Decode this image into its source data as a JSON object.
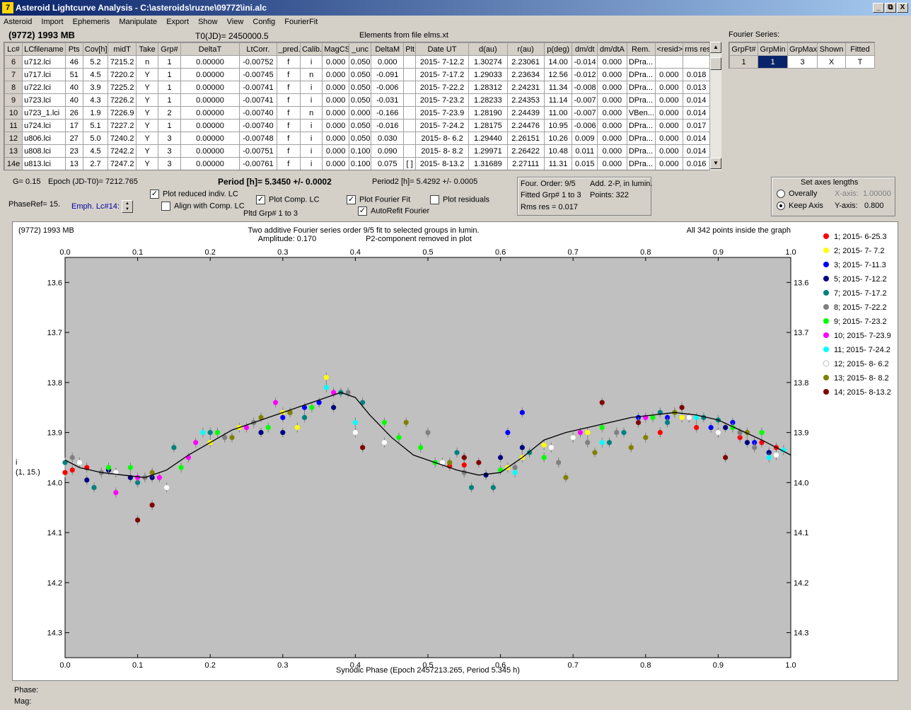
{
  "window": {
    "title": "Asteroid Lightcurve Analysis - C:\\asteroids\\ruzne\\09772\\ini.alc",
    "app_icon": "7",
    "buttons": [
      "_",
      "⧉",
      "X"
    ]
  },
  "menu": [
    "Asteroid",
    "Import",
    "Ephemeris",
    "Manipulate",
    "Export",
    "Show",
    "View",
    "Config",
    "FourierFit"
  ],
  "header": {
    "asteroid": "(9772) 1993 MB",
    "t0": "T0(JD)= 2450000.5",
    "elements": "Elements from file elms.xt",
    "fourier_label": "Fourier Series:"
  },
  "grid": {
    "columns": [
      "Lc#",
      "LCfilename",
      "Pts",
      "Cov[h]",
      "midT",
      "Take",
      "Grp#",
      "DeltaT",
      "LtCorr.",
      "_pred.",
      "Calib.",
      "MagCS",
      "_unc",
      "DeltaM",
      "Plt",
      "Date UT",
      "d(au)",
      "r(au)",
      "p(deg)",
      "dm/dt",
      "dm/dtA",
      "Rem.",
      "<resid>",
      "rms res"
    ],
    "rows": [
      [
        "6",
        "u712.lci",
        "46",
        "5.2",
        "7215.2",
        "n",
        "1",
        "0.00000",
        "-0.00752",
        "f",
        "i",
        "0.000",
        "0.050",
        "0.000",
        "",
        "2015- 7-12.2",
        "1.30274",
        "2.23061",
        "14.00",
        "-0.014",
        "0.000",
        "DPra...",
        "",
        ""
      ],
      [
        "7",
        "u717.lci",
        "51",
        "4.5",
        "7220.2",
        "Y",
        "1",
        "0.00000",
        "-0.00745",
        "f",
        "n",
        "0.000",
        "0.050",
        "-0.091",
        "",
        "2015- 7-17.2",
        "1.29033",
        "2.23634",
        "12.56",
        "-0.012",
        "0.000",
        "DPra...",
        "0.000",
        "0.018"
      ],
      [
        "8",
        "u722.lci",
        "40",
        "3.9",
        "7225.2",
        "Y",
        "1",
        "0.00000",
        "-0.00741",
        "f",
        "i",
        "0.000",
        "0.050",
        "-0.006",
        "",
        "2015- 7-22.2",
        "1.28312",
        "2.24231",
        "11.34",
        "-0.008",
        "0.000",
        "DPra...",
        "0.000",
        "0.013"
      ],
      [
        "9",
        "u723.lci",
        "40",
        "4.3",
        "7226.2",
        "Y",
        "1",
        "0.00000",
        "-0.00741",
        "f",
        "i",
        "0.000",
        "0.050",
        "-0.031",
        "",
        "2015- 7-23.2",
        "1.28233",
        "2.24353",
        "11.14",
        "-0.007",
        "0.000",
        "DPra...",
        "0.000",
        "0.014"
      ],
      [
        "10",
        "u723_1.lci",
        "26",
        "1.9",
        "7226.9",
        "Y",
        "2",
        "0.00000",
        "-0.00740",
        "f",
        "n",
        "0.000",
        "0.000",
        "-0.166",
        "",
        "2015- 7-23.9",
        "1.28190",
        "2.24439",
        "11.00",
        "-0.007",
        "0.000",
        "VBen...",
        "0.000",
        "0.014"
      ],
      [
        "11",
        "u724.lci",
        "17",
        "5.1",
        "7227.2",
        "Y",
        "1",
        "0.00000",
        "-0.00740",
        "f",
        "i",
        "0.000",
        "0.050",
        "-0.016",
        "",
        "2015- 7-24.2",
        "1.28175",
        "2.24476",
        "10.95",
        "-0.006",
        "0.000",
        "DPra...",
        "0.000",
        "0.017"
      ],
      [
        "12",
        "u806.lci",
        "27",
        "5.0",
        "7240.2",
        "Y",
        "3",
        "0.00000",
        "-0.00748",
        "f",
        "i",
        "0.000",
        "0.050",
        "0.030",
        "",
        "2015- 8- 6.2",
        "1.29440",
        "2.26151",
        "10.26",
        "0.009",
        "0.000",
        "DPra...",
        "0.000",
        "0.014"
      ],
      [
        "13",
        "u808.lci",
        "23",
        "4.5",
        "7242.2",
        "Y",
        "3",
        "0.00000",
        "-0.00751",
        "f",
        "i",
        "0.000",
        "0.100",
        "0.090",
        "",
        "2015- 8- 8.2",
        "1.29971",
        "2.26422",
        "10.48",
        "0.011",
        "0.000",
        "DPra...",
        "0.000",
        "0.014"
      ],
      [
        "14e",
        "u813.lci",
        "13",
        "2.7",
        "7247.2",
        "Y",
        "3",
        "0.00000",
        "-0.00761",
        "f",
        "i",
        "0.000",
        "0.100",
        "0.075",
        "[ ]",
        "2015- 8-13.2",
        "1.31689",
        "2.27111",
        "11.31",
        "0.015",
        "0.000",
        "DPra...",
        "0.000",
        "0.016"
      ]
    ]
  },
  "fourier": {
    "columns": [
      "GrpFt#",
      "GrpMin",
      "GrpMax",
      "Shown",
      "Fitted"
    ],
    "row": [
      "1",
      "1",
      "3",
      "X",
      "T"
    ]
  },
  "controls": {
    "g": "G= 0.15",
    "epoch": "Epoch (JD-T0)= 7212.765",
    "period": "Period [h]= 5.3450 +/- 0.0002",
    "period2": "Period2 [h]= 5.4292 +/- 0.0005",
    "phaseref": "PhaseRef= 15.",
    "emph": "Emph. Lc#14:",
    "cb_plot_reduced": "Plot reduced indiv. LC",
    "cb_align": "Align with Comp. LC",
    "cb_plot_comp": "Plot Comp. LC",
    "pltd_grp": "Pltd Grp#  1   to    3",
    "cb_plot_fourier": "Plot Fourier Fit",
    "cb_autorefit": "AutoRefit Fourier",
    "cb_plot_resid": "Plot residuals",
    "info_order": "Four. Order:  9/5",
    "info_add": "Add. 2-P, in lumin.",
    "info_fitted": "Fitted Grp# 1 to 3",
    "info_points": "Points: 322",
    "info_rms": "Rms res      = 0.017",
    "axes_title": "Set axes lengths",
    "axes_overall": "Overally",
    "axes_keep": "Keep Axis",
    "xaxis_label": "X-axis:",
    "xaxis_value": "1.00000",
    "yaxis_label": "Y-axis:",
    "yaxis_value": "0.800"
  },
  "status": {
    "phase": "Phase:",
    "mag": "Mag:"
  },
  "chart_data": {
    "type": "scatter",
    "top_left": "(9772) 1993 MB",
    "title": "Two additive Fourier series order 9/5 fit to selected groups in lumin.",
    "amplitude": "Amplitude: 0.170",
    "p2note": "P2-component removed in plot",
    "top_right": "All 342 points inside the graph",
    "xlabel": "Synodic Phase (Epoch 2457213.265, Period 5.345 h)",
    "ylabel": "i",
    "ylabel2": "(1, 15.)",
    "xlim": [
      0,
      1
    ],
    "ylim": [
      14.35,
      13.55
    ],
    "x_ticks": [
      "0.0",
      "0.1",
      "0.2",
      "0.3",
      "0.4",
      "0.5",
      "0.6",
      "0.7",
      "0.8",
      "0.9",
      "1.0"
    ],
    "y_ticks": [
      "13.6",
      "13.7",
      "13.8",
      "13.9",
      "14.0",
      "14.1",
      "14.2",
      "14.3"
    ],
    "legend_position": "right",
    "fit_curve": {
      "x": [
        0.0,
        0.02,
        0.05,
        0.08,
        0.11,
        0.14,
        0.17,
        0.2,
        0.23,
        0.26,
        0.29,
        0.32,
        0.35,
        0.38,
        0.4,
        0.42,
        0.45,
        0.48,
        0.51,
        0.54,
        0.57,
        0.6,
        0.63,
        0.66,
        0.69,
        0.72,
        0.75,
        0.78,
        0.81,
        0.84,
        0.87,
        0.9,
        0.93,
        0.96,
        1.0
      ],
      "y": [
        13.955,
        13.97,
        13.98,
        13.985,
        13.99,
        13.975,
        13.945,
        13.92,
        13.895,
        13.88,
        13.865,
        13.85,
        13.835,
        13.82,
        13.83,
        13.865,
        13.91,
        13.945,
        13.96,
        13.975,
        13.985,
        13.98,
        13.95,
        13.915,
        13.9,
        13.89,
        13.88,
        13.87,
        13.865,
        13.86,
        13.865,
        13.875,
        13.895,
        13.915,
        13.945
      ]
    },
    "series": [
      {
        "name": "1; 2015- 6-25.3",
        "color": "#ff0000",
        "x": [
          0.0,
          0.01,
          0.03,
          0.06,
          0.53,
          0.55,
          0.82,
          0.87,
          0.9,
          0.93,
          0.96,
          0.98
        ],
        "y": [
          13.98,
          13.975,
          13.97,
          13.975,
          13.967,
          13.965,
          13.9,
          13.89,
          13.9,
          13.91,
          13.92,
          13.93
        ]
      },
      {
        "name": "2; 2015- 7- 7.2",
        "color": "#ffff00",
        "x": [
          0.2,
          0.24,
          0.3,
          0.32,
          0.36,
          0.58,
          0.61,
          0.63,
          0.66,
          0.72,
          0.85
        ],
        "y": [
          13.92,
          13.89,
          13.86,
          13.89,
          13.79,
          13.985,
          13.97,
          13.95,
          13.925,
          13.9,
          13.87
        ]
      },
      {
        "name": "3; 2015- 7-11.3",
        "color": "#0000ff",
        "x": [
          0.3,
          0.31,
          0.33,
          0.35,
          0.61,
          0.63,
          0.79,
          0.83,
          0.89,
          0.92,
          0.95,
          0.97
        ],
        "y": [
          13.87,
          13.86,
          13.85,
          13.84,
          13.9,
          13.86,
          13.87,
          13.87,
          13.89,
          13.88,
          13.92,
          13.94
        ]
      },
      {
        "name": "5; 2015- 7-12.2",
        "color": "#000080",
        "x": [
          0.03,
          0.06,
          0.09,
          0.12,
          0.27,
          0.3,
          0.37,
          0.58,
          0.6,
          0.63,
          0.91,
          0.94,
          0.97
        ],
        "y": [
          13.995,
          13.975,
          13.99,
          13.99,
          13.9,
          13.9,
          13.85,
          13.985,
          13.95,
          13.93,
          13.89,
          13.92,
          13.94
        ]
      },
      {
        "name": "7; 2015- 7-17.2",
        "color": "#008080",
        "x": [
          0.0,
          0.04,
          0.1,
          0.15,
          0.2,
          0.33,
          0.38,
          0.41,
          0.54,
          0.55,
          0.56,
          0.59,
          0.64,
          0.75,
          0.77,
          0.82,
          0.83,
          0.88,
          0.9
        ],
        "y": [
          13.96,
          14.01,
          14.0,
          13.93,
          13.9,
          13.87,
          13.82,
          13.84,
          13.94,
          13.95,
          14.01,
          14.01,
          13.94,
          13.92,
          13.9,
          13.86,
          13.88,
          13.87,
          13.875
        ]
      },
      {
        "name": "8; 2015- 7-22.2",
        "color": "#808080",
        "x": [
          0.01,
          0.05,
          0.11,
          0.22,
          0.26,
          0.39,
          0.5,
          0.55,
          0.62,
          0.68,
          0.72,
          0.76,
          0.86,
          0.93,
          0.95
        ],
        "y": [
          13.95,
          13.98,
          13.99,
          13.91,
          13.88,
          13.82,
          13.9,
          13.98,
          13.97,
          13.96,
          13.92,
          13.9,
          13.87,
          13.9,
          13.93
        ]
      },
      {
        "name": "9; 2015- 7-23.2",
        "color": "#00ff00",
        "x": [
          0.06,
          0.09,
          0.16,
          0.21,
          0.28,
          0.34,
          0.44,
          0.46,
          0.49,
          0.51,
          0.6,
          0.66,
          0.7,
          0.74,
          0.81,
          0.84,
          0.92,
          0.96
        ],
        "y": [
          13.97,
          13.97,
          13.97,
          13.9,
          13.89,
          13.85,
          13.88,
          13.91,
          13.93,
          13.96,
          13.975,
          13.95,
          13.91,
          13.89,
          13.87,
          13.86,
          13.89,
          13.9
        ]
      },
      {
        "name": "10; 2015- 7-23.9",
        "color": "#ff00ff",
        "x": [
          0.07,
          0.1,
          0.13,
          0.17,
          0.18,
          0.25,
          0.29,
          0.37,
          0.71,
          0.8
        ],
        "y": [
          14.02,
          13.99,
          13.99,
          13.95,
          13.92,
          13.89,
          13.84,
          13.82,
          13.9,
          13.87
        ]
      },
      {
        "name": "11; 2015- 7-24.2",
        "color": "#00ffff",
        "x": [
          0.19,
          0.36,
          0.4,
          0.62,
          0.74,
          0.87,
          0.97,
          0.99
        ],
        "y": [
          13.9,
          13.81,
          13.88,
          13.98,
          13.92,
          13.87,
          13.95,
          13.935
        ]
      },
      {
        "name": "12; 2015- 8- 6.2",
        "color": "#ffffff",
        "x": [
          0.02,
          0.07,
          0.14,
          0.4,
          0.44,
          0.52,
          0.67,
          0.7,
          0.86,
          0.9,
          0.98
        ],
        "y": [
          13.96,
          13.98,
          14.01,
          13.9,
          13.92,
          13.96,
          13.93,
          13.91,
          13.87,
          13.9,
          13.945
        ]
      },
      {
        "name": "13; 2015- 8- 8.2",
        "color": "#808000",
        "x": [
          0.12,
          0.23,
          0.27,
          0.31,
          0.47,
          0.53,
          0.69,
          0.73,
          0.78,
          0.8,
          0.84,
          0.94
        ],
        "y": [
          13.98,
          13.91,
          13.87,
          13.86,
          13.88,
          13.96,
          13.99,
          13.94,
          13.93,
          13.91,
          13.86,
          13.9
        ]
      },
      {
        "name": "14; 2015- 8-13.2",
        "color": "#800000",
        "x": [
          0.1,
          0.12,
          0.41,
          0.55,
          0.57,
          0.74,
          0.79,
          0.85,
          0.91
        ],
        "y": [
          14.075,
          14.045,
          13.93,
          13.95,
          13.96,
          13.84,
          13.88,
          13.85,
          13.95
        ]
      }
    ]
  }
}
